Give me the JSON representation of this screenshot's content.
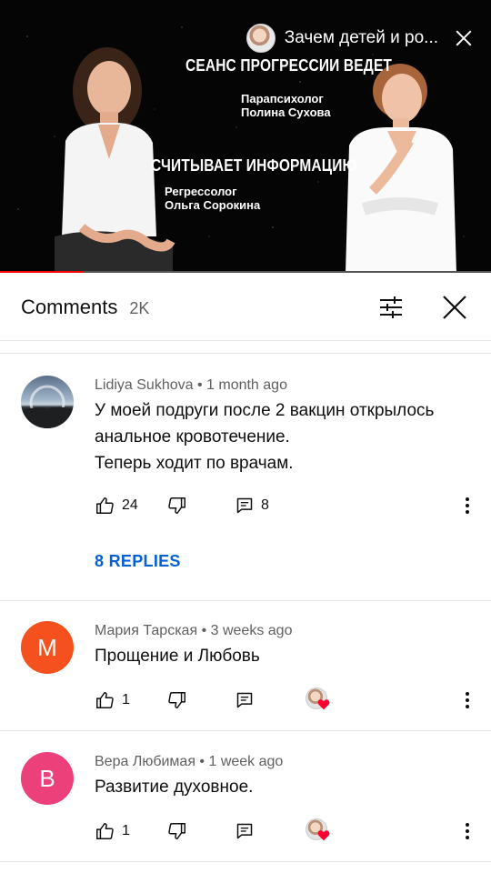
{
  "video": {
    "title": "Зачем детей и ро...",
    "overlay_heading_1": "СЕАНС ПРОГРЕССИИ ВЕДЕТ",
    "overlay_role_1": "Парапсихолог",
    "overlay_name_1": "Полина Сухова",
    "overlay_heading_2": "СЧИТЫВАЕТ ИНФОРМАЦИЮ",
    "overlay_role_2": "Регрессолог",
    "overlay_name_2": "Ольга Сорокина",
    "progress_fraction": 0.17,
    "progress_color": "#ff0000"
  },
  "comments_header": {
    "title": "Comments",
    "count": "2K",
    "filter_icon": "sliders-icon",
    "close_icon": "close-icon"
  },
  "comments": [
    {
      "author": "Lidiya Sukhova",
      "time": "1 month ago",
      "text": "У моей подруги после 2 вакцин открылось\nанальное кровотечение.\nТеперь ходит по врачам.",
      "likes": "24",
      "replies_count": "8",
      "replies_label": "8 REPLIES",
      "avatar_type": "photo"
    },
    {
      "author": "Мария Тарская",
      "time": "3 weeks ago",
      "text": "Прощение и Любовь",
      "likes": "1",
      "avatar_letter": "М",
      "avatar_color": "#f4511e",
      "creator_heart": true
    },
    {
      "author": "Вера Любимая",
      "time": "1 week ago",
      "text": "Развитие духовное.",
      "likes": "1",
      "avatar_letter": "В",
      "avatar_color": "#ec407a",
      "creator_heart": true
    }
  ],
  "colors": {
    "link_blue": "#065fd4",
    "secondary_text": "#606060",
    "heart_red": "#ff0033"
  }
}
